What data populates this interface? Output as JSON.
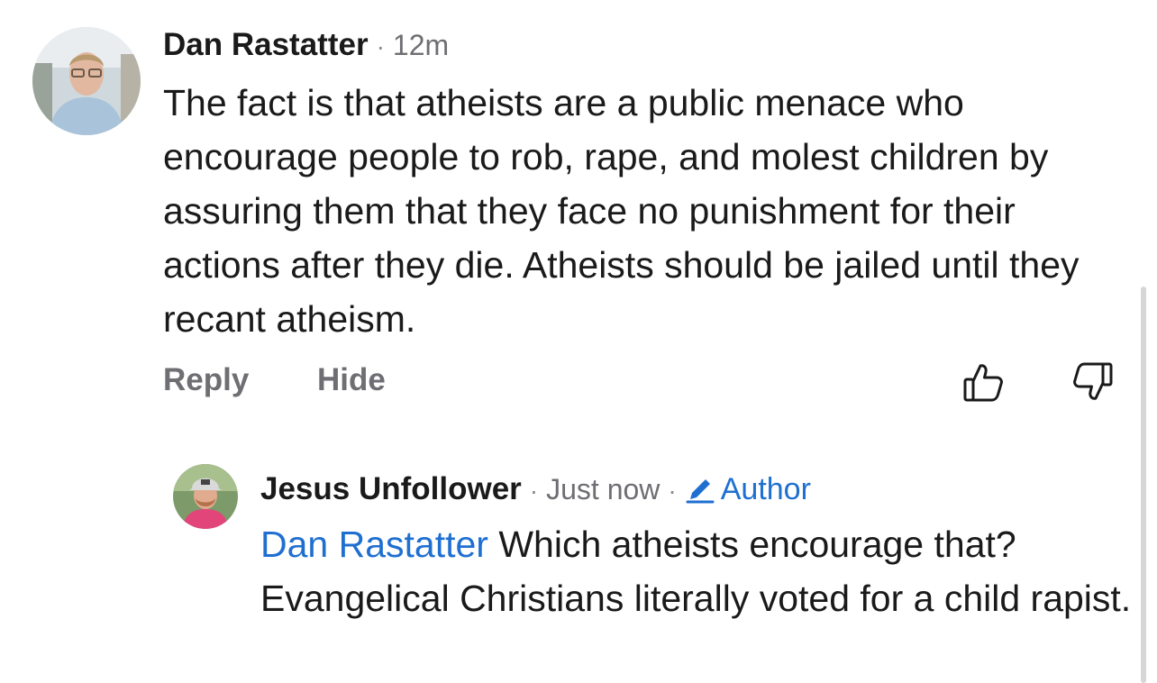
{
  "comments": [
    {
      "author": "Dan Rastatter",
      "separator": "·",
      "time": "12m",
      "body": "The fact is that atheists are a public menace who encourage people to rob, rape, and molest children by assuring them that they face no punishment for their actions after they die. Atheists should be jailed until they recant atheism.",
      "avatar_icon": "user-photo-avatar"
    }
  ],
  "actions": {
    "reply_label": "Reply",
    "hide_label": "Hide",
    "upvote_icon": "thumbs-up-icon",
    "downvote_icon": "thumbs-down-icon"
  },
  "reply": {
    "author": "Jesus Unfollower",
    "separator": "·",
    "time": "Just now",
    "separator2": "·",
    "badge_label": "Author",
    "badge_icon": "pencil-icon",
    "mention": "Dan Rastatter",
    "body": " Which atheists encourage that? Evangelical Christians literally voted for a child rapist.",
    "avatar_icon": "user-photo-avatar"
  },
  "colors": {
    "mention": "#1f6fd1",
    "meta_text": "#6e6e73",
    "body_text": "#1a1a1a"
  }
}
